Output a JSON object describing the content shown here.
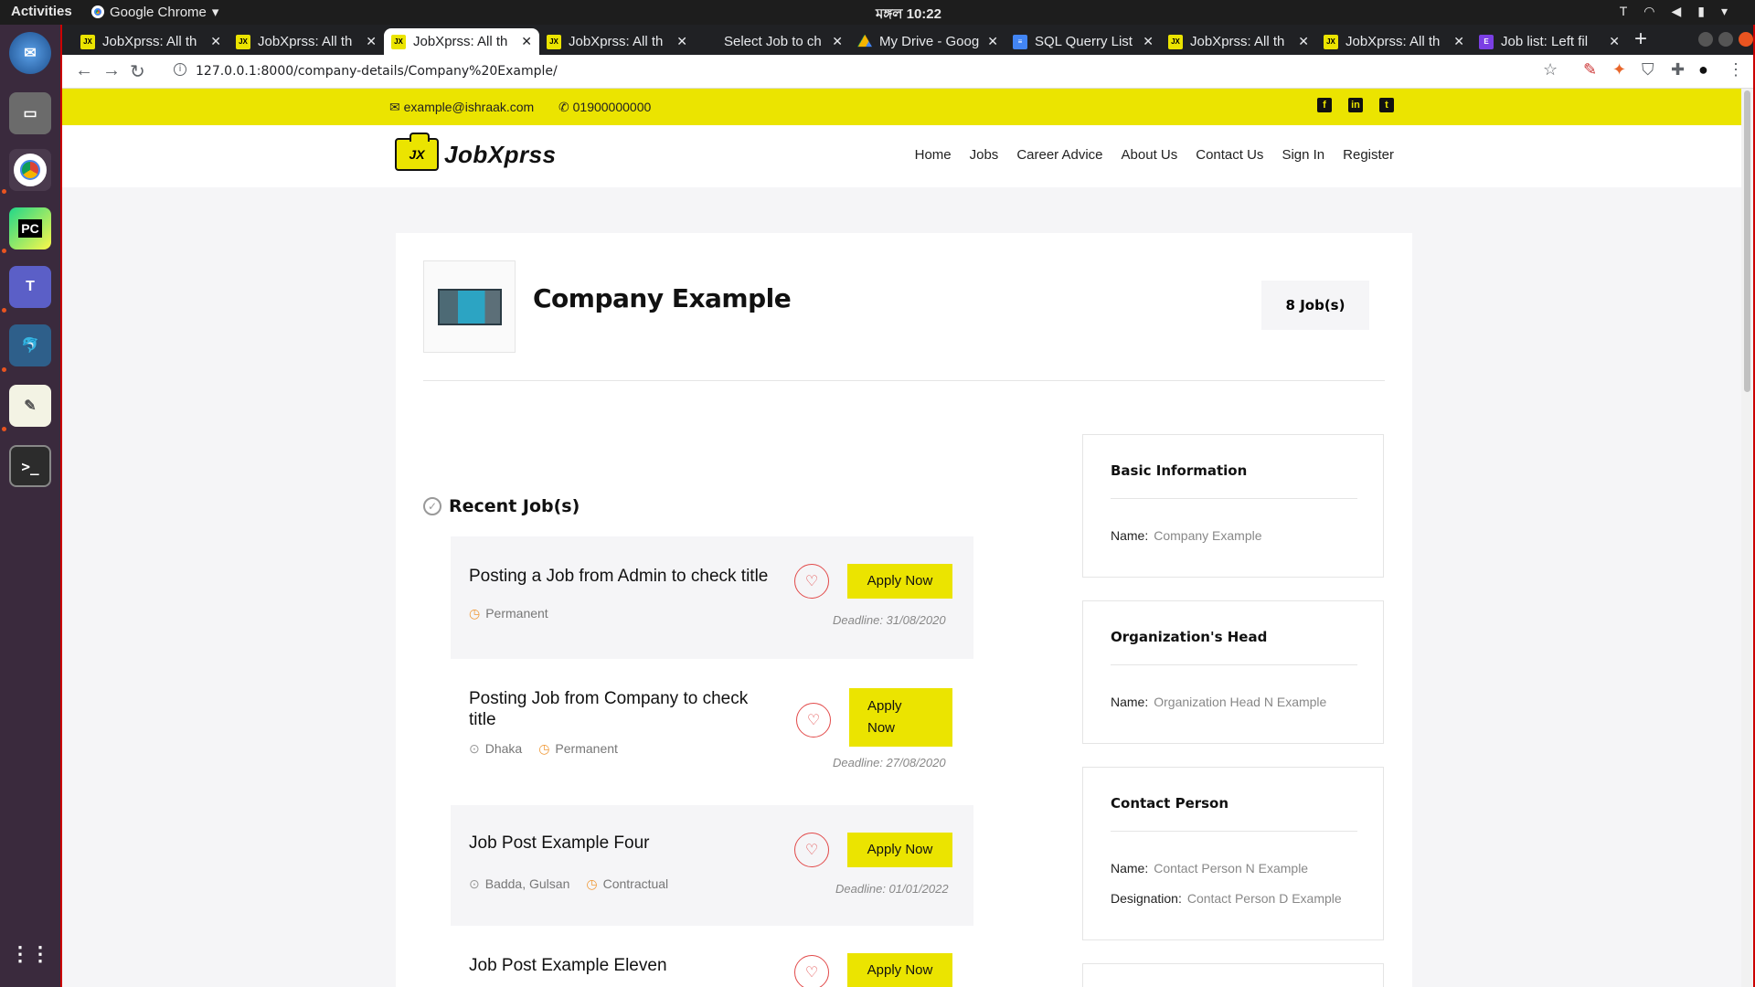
{
  "os": {
    "activities": "Activities",
    "app_name": "Google Chrome",
    "clock": "মঙ্গল 10:22"
  },
  "tabs": [
    {
      "title": "JobXprss: All th",
      "favicon": "JX"
    },
    {
      "title": "JobXprss: All th",
      "favicon": "JX"
    },
    {
      "title": "JobXprss: All th",
      "favicon": "JX",
      "active": true
    },
    {
      "title": "JobXprss: All th",
      "favicon": "JX"
    },
    {
      "title": "Select Job to ch",
      "favicon": ""
    },
    {
      "title": "My Drive - Goog",
      "favicon": "drive"
    },
    {
      "title": "SQL Querry List",
      "favicon": "doc"
    },
    {
      "title": "JobXprss: All th",
      "favicon": "JX"
    },
    {
      "title": "JobXprss: All th",
      "favicon": "JX"
    },
    {
      "title": "Job list: Left fil",
      "favicon": "E"
    }
  ],
  "address": {
    "url": "127.0.0.1:8000/company-details/Company%20Example/"
  },
  "site": {
    "email": "example@ishraak.com",
    "phone": "01900000000",
    "logo_badge": "JX",
    "logo_text": "JobXprss",
    "menu": [
      "Home",
      "Jobs",
      "Career Advice",
      "About Us",
      "Contact Us",
      "Sign In",
      "Register"
    ]
  },
  "company": {
    "name": "Company Example",
    "job_count": "8 Job(s)",
    "recent_heading": "Recent Job(s)"
  },
  "jobs": [
    {
      "title": "Posting a Job from Admin to check title",
      "location": "",
      "type": "Permanent",
      "apply": "Apply Now",
      "deadline": "Deadline: 31/08/2020"
    },
    {
      "title": "Posting Job from Company to check title",
      "location": "Dhaka",
      "type": "Permanent",
      "apply": "Apply Now",
      "deadline": "Deadline: 27/08/2020"
    },
    {
      "title": "Job Post Example Four",
      "location": "Badda, Gulsan",
      "type": "Contractual",
      "apply": "Apply Now",
      "deadline": "Deadline: 01/01/2022"
    },
    {
      "title": "Job Post Example Eleven",
      "location": "",
      "type": "",
      "apply": "Apply Now",
      "deadline": ""
    }
  ],
  "sidebar": {
    "basic": {
      "heading": "Basic Information",
      "name_label": "Name:",
      "name_value": "Company Example"
    },
    "head": {
      "heading": "Organization's Head",
      "name_label": "Name:",
      "name_value": "Organization Head N Example"
    },
    "contact": {
      "heading": "Contact Person",
      "name_label": "Name:",
      "name_value": "Contact Person N Example",
      "designation_label": "Designation:",
      "designation_value": "Contact Person D Example"
    }
  },
  "colors": {
    "brand_yellow": "#ebe400",
    "heart_red": "#e24a4a",
    "meta_orange": "#f09a39"
  }
}
